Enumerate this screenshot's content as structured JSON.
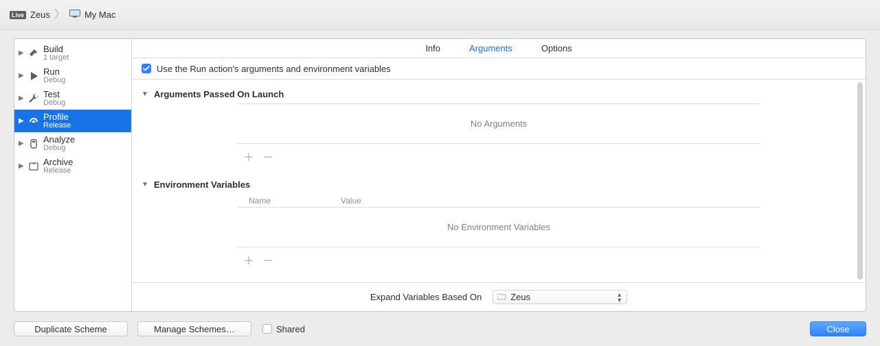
{
  "breadcrumb": {
    "badge": "Live",
    "scheme": "Zeus",
    "destination": "My Mac"
  },
  "sidebar": {
    "items": [
      {
        "title": "Build",
        "subtitle": "1 target"
      },
      {
        "title": "Run",
        "subtitle": "Debug"
      },
      {
        "title": "Test",
        "subtitle": "Debug"
      },
      {
        "title": "Profile",
        "subtitle": "Release"
      },
      {
        "title": "Analyze",
        "subtitle": "Debug"
      },
      {
        "title": "Archive",
        "subtitle": "Release"
      }
    ],
    "selected_index": 3
  },
  "tabs": {
    "info": "Info",
    "arguments": "Arguments",
    "options": "Options",
    "active": "arguments"
  },
  "use_run_args": {
    "checked": true,
    "label": "Use the Run action's arguments and environment variables"
  },
  "arguments_section": {
    "title": "Arguments Passed On Launch",
    "empty_text": "No Arguments"
  },
  "env_section": {
    "title": "Environment Variables",
    "name_header": "Name",
    "value_header": "Value",
    "empty_text": "No Environment Variables"
  },
  "expand": {
    "label": "Expand Variables Based On",
    "value": "Zeus"
  },
  "footer": {
    "duplicate": "Duplicate Scheme",
    "manage": "Manage Schemes…",
    "shared_label": "Shared",
    "shared_checked": false,
    "close": "Close"
  }
}
